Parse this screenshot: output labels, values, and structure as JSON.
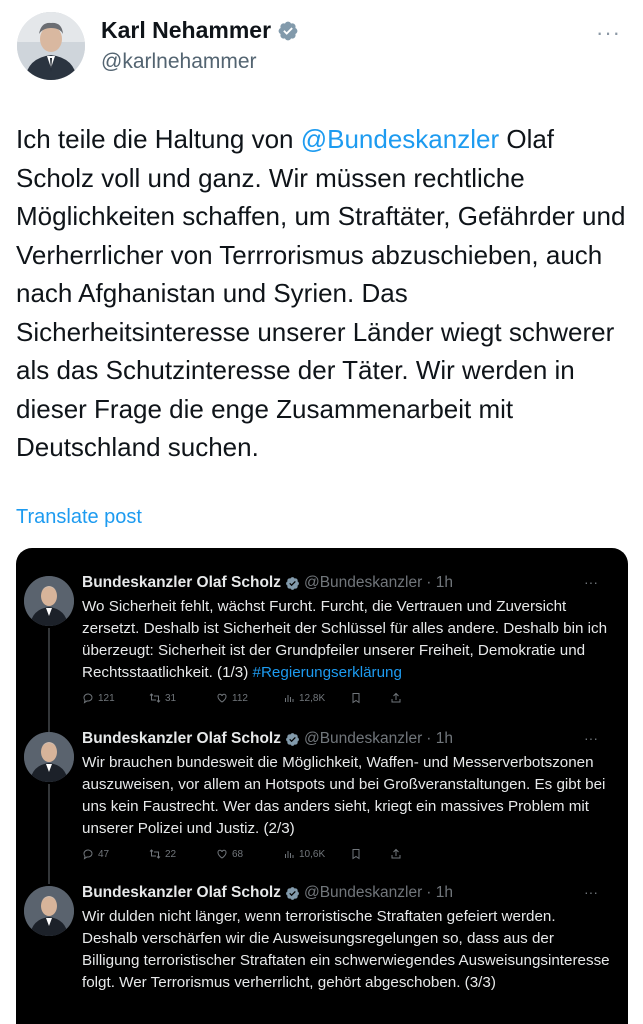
{
  "author": {
    "name": "Karl Nehammer",
    "handle": "@karlnehammer"
  },
  "tweet": {
    "text_before": "Ich teile die Haltung von ",
    "mention": "@Bundeskanzler",
    "text_after": " Olaf Scholz voll und ganz. Wir müssen rechtliche Möglichkeiten schaffen, um Straftäter, Gefährder und Verherrlicher von Terrrorismus abzuschieben, auch nach Afghanistan und Syrien. Das Sicherheitsinteresse unserer Länder wiegt schwerer als das Schutzinteresse der Täter. Wir werden in dieser Frage die enge Zusammenarbeit mit Deutschland suchen."
  },
  "translate_label": "Translate post",
  "more_label": "···",
  "embedded": {
    "posts": [
      {
        "name": "Bundeskanzler Olaf Scholz",
        "handle": "@Bundeskanzler",
        "time": "· 1h",
        "more": "···",
        "text": "Wo Sicherheit fehlt, wächst Furcht. Furcht, die Vertrauen und Zuversicht zersetzt. Deshalb ist Sicherheit der Schlüssel für alles andere. Deshalb bin ich überzeugt: Sicherheit ist der Grundpfeiler unserer Freiheit, Demokratie und Rechtsstaatlichkeit. (1/3) ",
        "hashtag": "#Regierungserklärung",
        "replies": "121",
        "reposts": "31",
        "likes": "112",
        "views": "12,8K"
      },
      {
        "name": "Bundeskanzler Olaf Scholz",
        "handle": "@Bundeskanzler",
        "time": "· 1h",
        "more": "···",
        "text": "Wir brauchen bundesweit die Möglichkeit, Waffen- und Messerverbotszonen auszuweisen, vor allem an Hotspots und bei Großveranstaltungen. Es gibt bei uns kein Faustrecht. Wer das anders sieht, kriegt ein massives Problem mit unserer Polizei und Justiz. (2/3)",
        "replies": "47",
        "reposts": "22",
        "likes": "68",
        "views": "10,6K"
      },
      {
        "name": "Bundeskanzler Olaf Scholz",
        "handle": "@Bundeskanzler",
        "time": "· 1h",
        "more": "···",
        "text": "Wir dulden nicht länger, wenn terroristische Straftaten gefeiert werden. Deshalb verschärfen wir die Ausweisungsregelungen so, dass aus der Billigung terroristischer Straftaten ein schwerwiegendes Ausweisungsinteresse folgt. Wer Terrorismus verherrlicht, gehört abgeschoben. (3/3)"
      }
    ]
  },
  "colors": {
    "accent": "#1d9bf0",
    "text": "#0f1419",
    "muted": "#536471",
    "embed_bg": "#000000",
    "embed_text": "#e7e9ea",
    "embed_muted": "#71767b"
  }
}
